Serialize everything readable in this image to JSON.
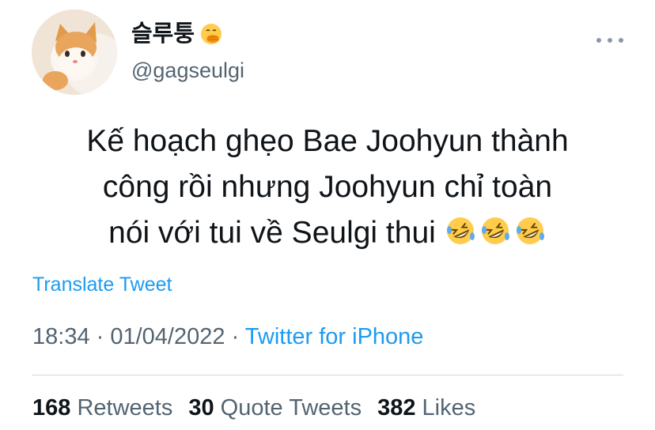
{
  "author": {
    "display_name": "슬루퉁",
    "handle": "@gagseulgi",
    "avatar_icon": "kitten-avatar",
    "name_emoji": "face-with-hand-over-mouth-icon"
  },
  "tweet": {
    "lines": [
      "Kế hoạch ghẹo Bae Joohyun thành",
      "công rồi nhưng Joohyun chỉ toàn",
      "nói với tui về Seulgi thui"
    ],
    "emojis": [
      "rofl-icon",
      "rofl-icon",
      "rofl-icon"
    ]
  },
  "translate_label": "Translate Tweet",
  "meta": {
    "time": "18:34",
    "separator": " · ",
    "date": "01/04/2022",
    "source": "Twitter for iPhone"
  },
  "stats": {
    "retweets_count": "168",
    "retweets_label": "Retweets",
    "quotes_count": "30",
    "quotes_label": "Quote Tweets",
    "likes_count": "382",
    "likes_label": "Likes"
  },
  "colors": {
    "link": "#1d9bf0",
    "muted": "#536471",
    "text": "#0f1419",
    "divider": "#cfd9de"
  }
}
